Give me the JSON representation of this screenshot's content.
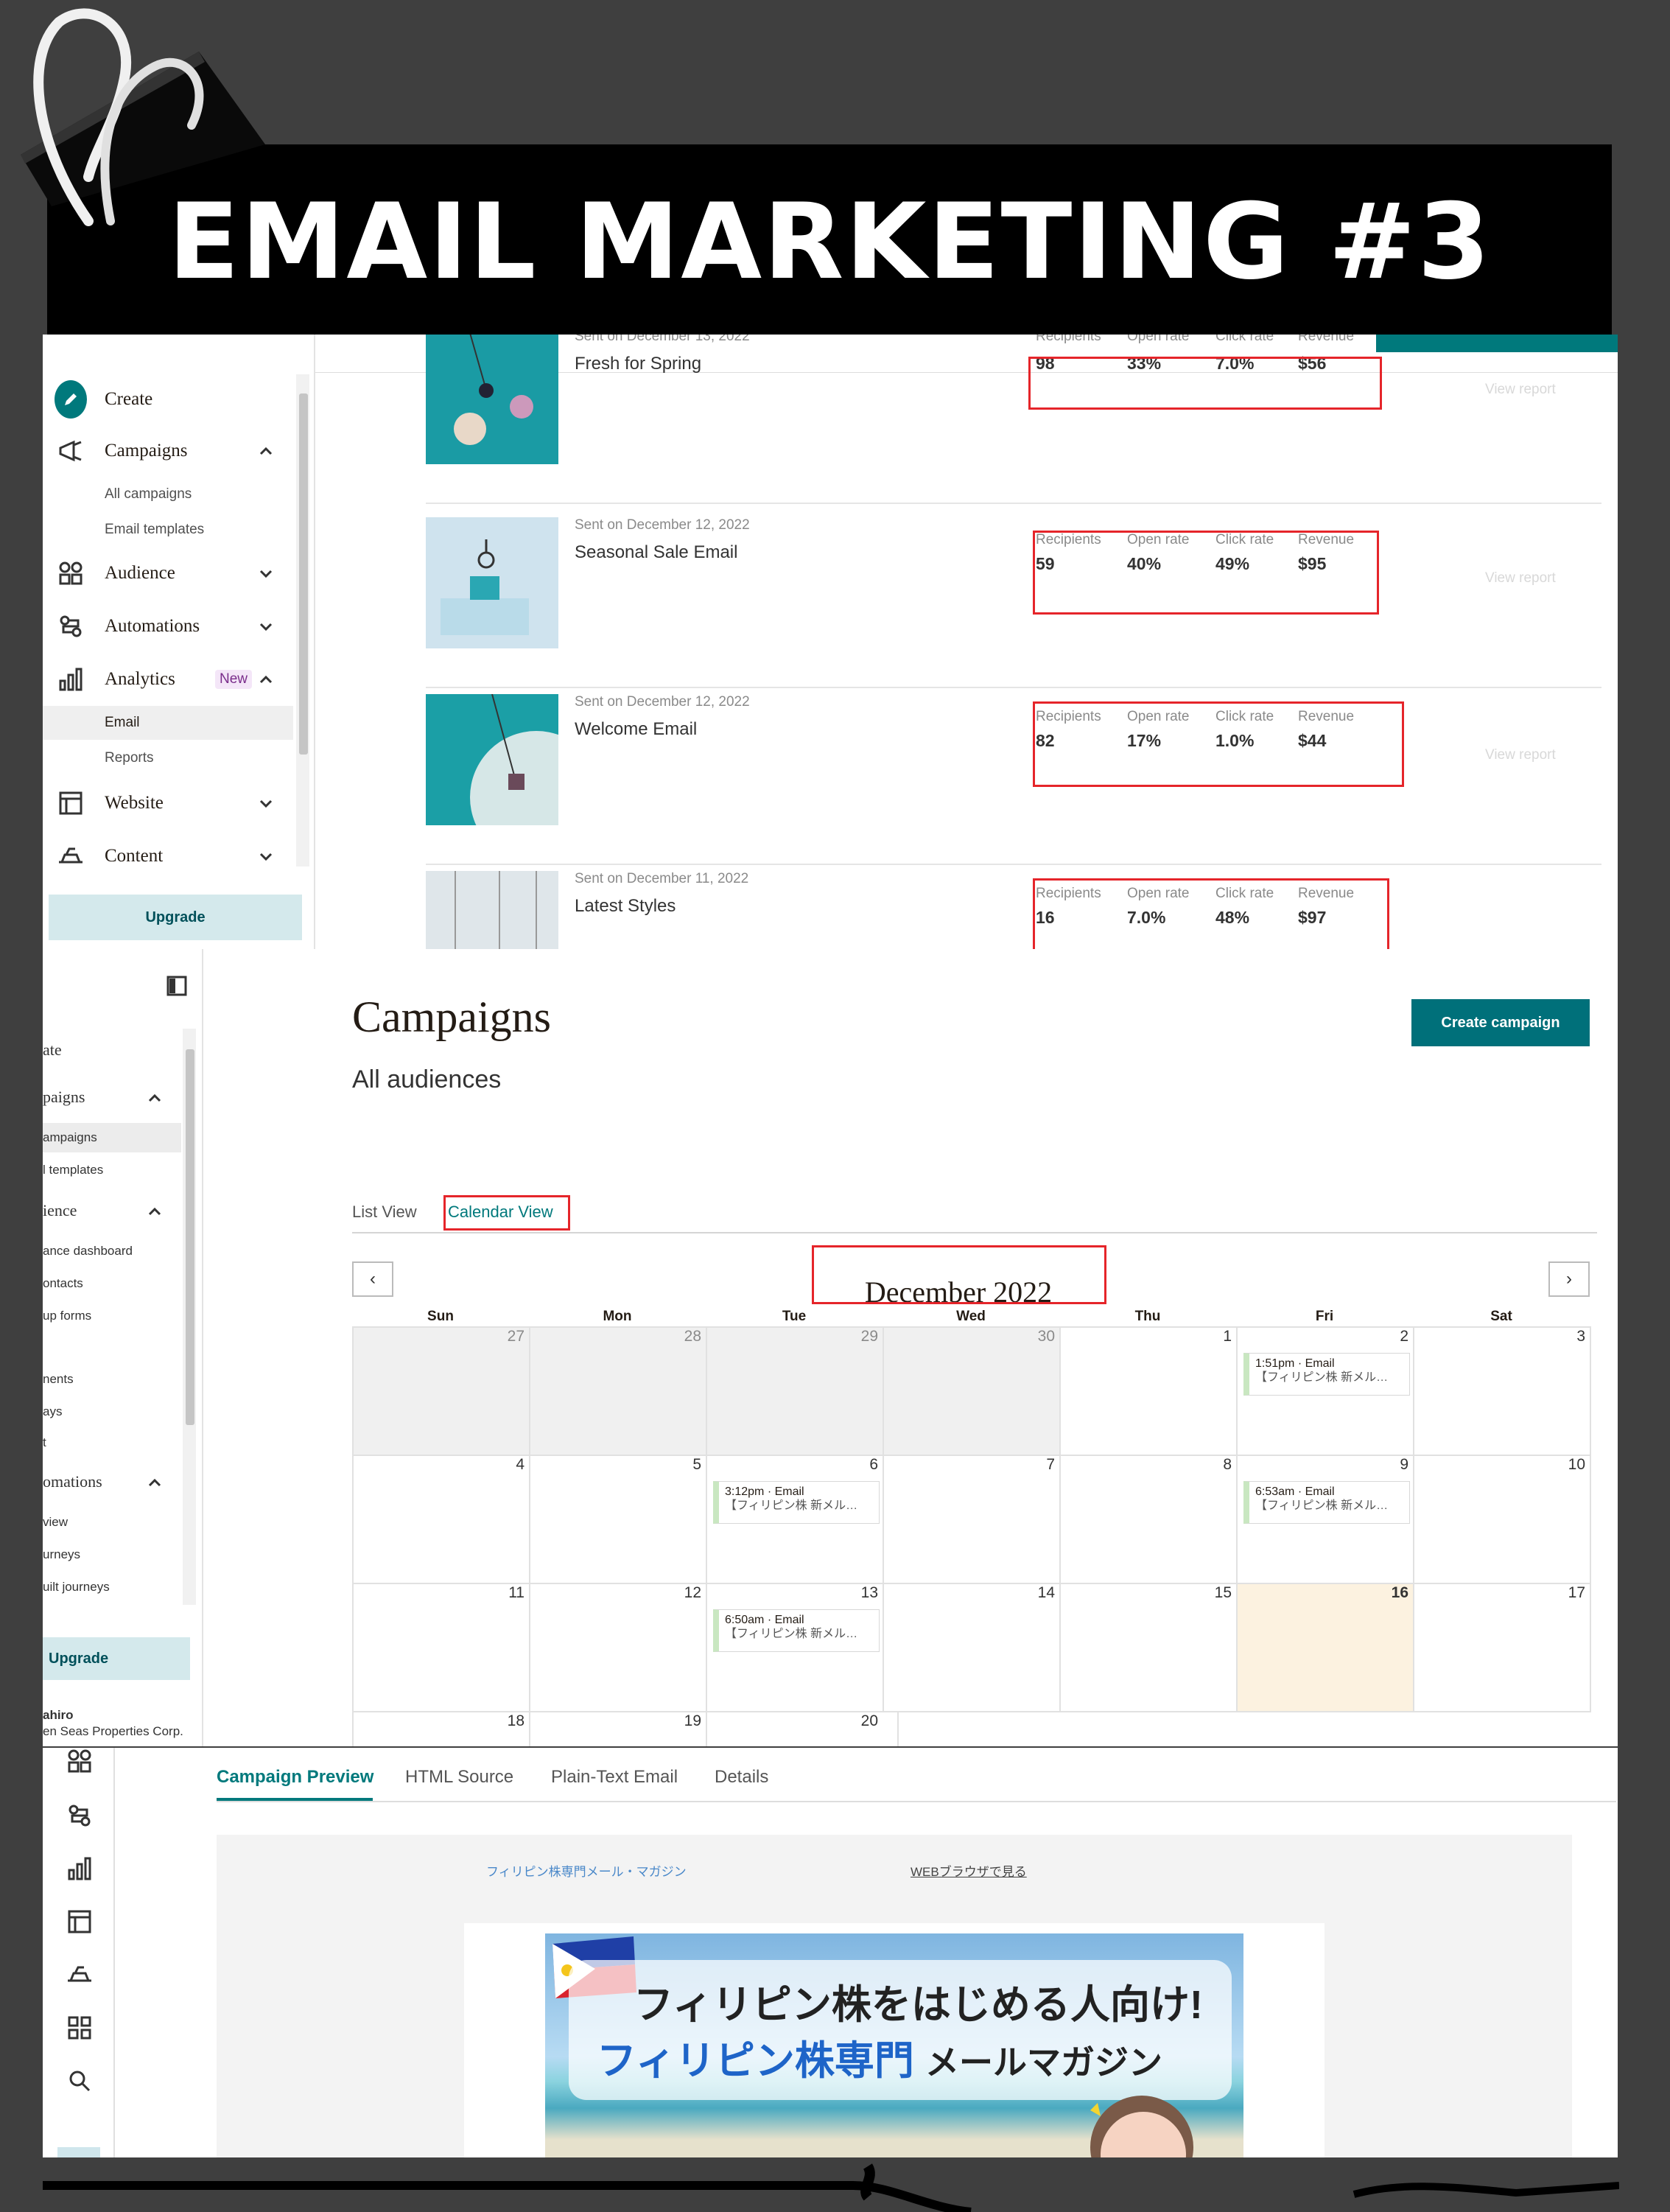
{
  "banner": {
    "title": "EMAIL MARKETING #3"
  },
  "dashboard": {
    "sidebar": {
      "create": "Create",
      "campaigns": "Campaigns",
      "campaign_subs": [
        "All campaigns",
        "Email templates"
      ],
      "audience": "Audience",
      "automations": "Automations",
      "analytics": "Analytics",
      "new_badge": "New",
      "analytics_subs": [
        "Email",
        "Reports"
      ],
      "website": "Website",
      "content": "Content",
      "upgrade": "Upgrade"
    },
    "metric_labels": [
      "Recipients",
      "Open rate",
      "Click rate",
      "Revenue"
    ],
    "view_report": "View report",
    "campaigns": [
      {
        "sent": "Sent on December 13, 2022",
        "title": "Fresh for Spring",
        "values": [
          "98",
          "33%",
          "7.0%",
          "$56"
        ]
      },
      {
        "sent": "Sent on December 12, 2022",
        "title": "Seasonal Sale Email",
        "values": [
          "59",
          "40%",
          "49%",
          "$95"
        ]
      },
      {
        "sent": "Sent on December 12, 2022",
        "title": "Welcome Email",
        "values": [
          "82",
          "17%",
          "1.0%",
          "$44"
        ]
      },
      {
        "sent": "Sent on December 11, 2022",
        "title": "Latest Styles",
        "values": [
          "16",
          "7.0%",
          "48%",
          "$97"
        ]
      }
    ]
  },
  "calendar_page": {
    "sidebar": {
      "items": [
        "ate",
        "paigns",
        "ampaigns",
        "l templates",
        "ience",
        "ance dashboard",
        "ontacts",
        "up forms",
        "nents",
        "ays",
        "t",
        "omations",
        "view",
        "urneys",
        "uilt journeys"
      ],
      "upgrade": "Upgrade",
      "user_name": "ahiro",
      "user_org": "en Seas Properties Corp."
    },
    "title": "Campaigns",
    "subtitle": "All audiences",
    "create_button": "Create campaign",
    "tabs": [
      "List View",
      "Calendar View"
    ],
    "month": "December 2022",
    "prev": "‹",
    "next": "›",
    "weekdays": [
      "Sun",
      "Mon",
      "Tue",
      "Wed",
      "Thu",
      "Fri",
      "Sat"
    ],
    "weeks": [
      [
        "27",
        "28",
        "29",
        "30",
        "1",
        "2",
        "3"
      ],
      [
        "4",
        "5",
        "6",
        "7",
        "8",
        "9",
        "10"
      ],
      [
        "11",
        "12",
        "13",
        "14",
        "15",
        "16",
        "17"
      ],
      [
        "18",
        "19",
        "20"
      ]
    ],
    "events": [
      {
        "time": "1:51pm · Email",
        "subject": "【フィリピン株 新メル…"
      },
      {
        "time": "3:12pm · Email",
        "subject": "【フィリピン株 新メル…"
      },
      {
        "time": "6:53am · Email",
        "subject": "【フィリピン株 新メル…"
      },
      {
        "time": "6:50am · Email",
        "subject": "【フィリピン株 新メル…"
      }
    ]
  },
  "preview": {
    "tabs": [
      "Campaign Preview",
      "HTML Source",
      "Plain-Text Email",
      "Details"
    ],
    "magazine_name": "フィリピン株専門メール・マガジン",
    "browser_link": "WEBブラウザで見る",
    "hero_line1": "フィリピン株をはじめる人向け!",
    "hero_line2a": "フィリピン株専門",
    "hero_line2b": "メールマガジン"
  },
  "colors": {
    "accent": "#00797c",
    "highlight": "#e5252a",
    "banner": "#000000"
  }
}
